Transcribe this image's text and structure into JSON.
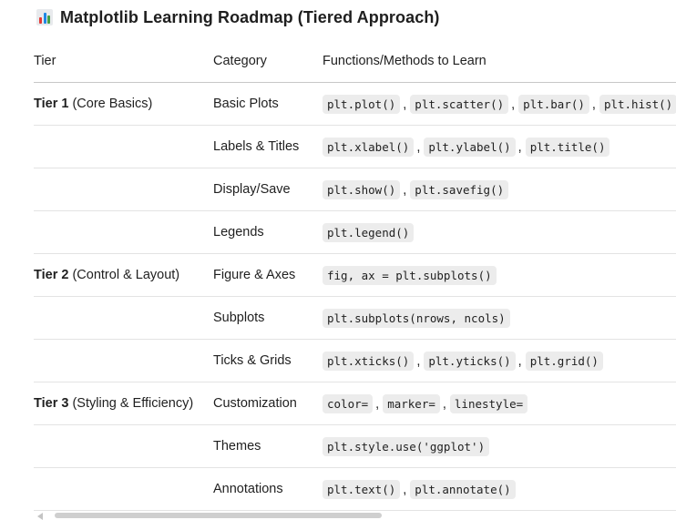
{
  "title": "Matplotlib Learning Roadmap (Tiered Approach)",
  "title_icon": "bar-chart-icon",
  "table": {
    "headers": [
      "Tier",
      "Category",
      "Functions/Methods to Learn"
    ],
    "rows": [
      {
        "tier_bold": "Tier 1",
        "tier_rest": "(Core Basics)",
        "category": "Basic Plots",
        "functions": [
          "plt.plot()",
          "plt.scatter()",
          "plt.bar()",
          "plt.hist()"
        ]
      },
      {
        "tier_bold": "",
        "tier_rest": "",
        "category": "Labels & Titles",
        "functions": [
          "plt.xlabel()",
          "plt.ylabel()",
          "plt.title()"
        ]
      },
      {
        "tier_bold": "",
        "tier_rest": "",
        "category": "Display/Save",
        "functions": [
          "plt.show()",
          "plt.savefig()"
        ]
      },
      {
        "tier_bold": "",
        "tier_rest": "",
        "category": "Legends",
        "functions": [
          "plt.legend()"
        ]
      },
      {
        "tier_bold": "Tier 2",
        "tier_rest": "(Control & Layout)",
        "category": "Figure & Axes",
        "functions": [
          "fig, ax = plt.subplots()"
        ]
      },
      {
        "tier_bold": "",
        "tier_rest": "",
        "category": "Subplots",
        "functions": [
          "plt.subplots(nrows, ncols)"
        ]
      },
      {
        "tier_bold": "",
        "tier_rest": "",
        "category": "Ticks & Grids",
        "functions": [
          "plt.xticks()",
          "plt.yticks()",
          "plt.grid()"
        ]
      },
      {
        "tier_bold": "Tier 3",
        "tier_rest": "(Styling & Efficiency)",
        "category": "Customization",
        "functions": [
          "color=",
          "marker=",
          "linestyle="
        ]
      },
      {
        "tier_bold": "",
        "tier_rest": "",
        "category": "Themes",
        "functions": [
          "plt.style.use('ggplot')"
        ]
      },
      {
        "tier_bold": "",
        "tier_rest": "",
        "category": "Annotations",
        "functions": [
          "plt.text()",
          "plt.annotate()"
        ]
      }
    ]
  },
  "separator": ","
}
